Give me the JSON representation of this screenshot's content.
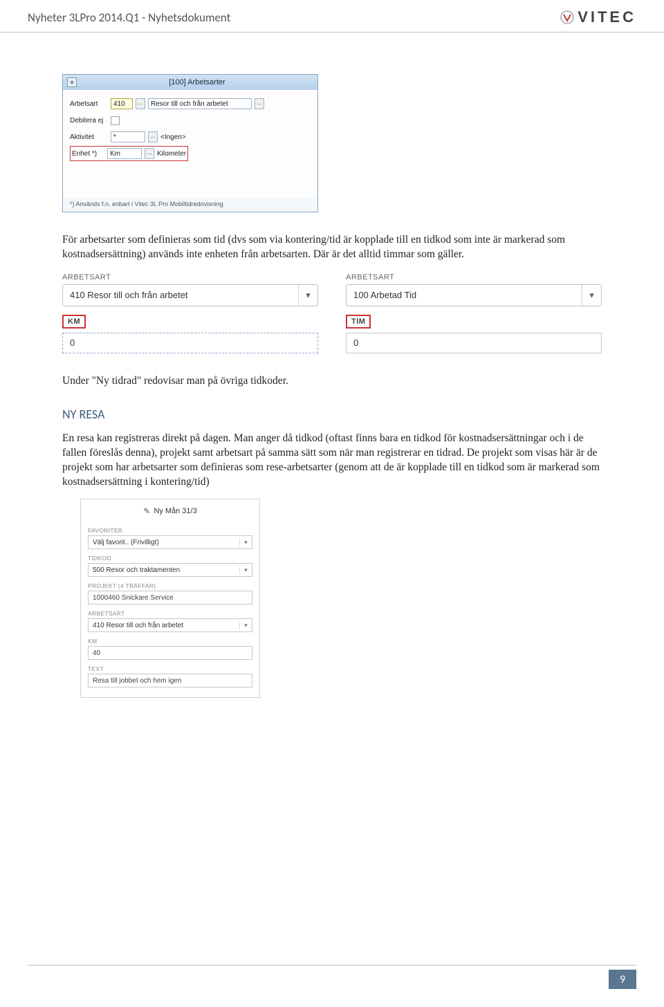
{
  "header": {
    "title": "Nyheter 3LPro 2014.Q1 - Nyhetsdokument",
    "brand": "VITEC"
  },
  "page_number": "9",
  "scr1": {
    "window_title": "[100]  Arbetsarter",
    "rows": {
      "arbetsart": {
        "label": "Arbetsart",
        "code": "410",
        "desc": "Resor till och från arbetet"
      },
      "debitera": {
        "label": "Debitera ej"
      },
      "aktivitet": {
        "label": "Aktivitet",
        "code": "*",
        "desc": "<Ingen>"
      },
      "enhet": {
        "label": "Enhet *)",
        "code": "Km",
        "desc": "Kilometer"
      }
    },
    "footnote": "*) Används f.n. enbart i Vitec 3L Pro Mobiltidredovisning."
  },
  "para1": "För arbetsarter som definieras som tid (dvs som via kontering/tid är kopplade till en tidkod som inte är markerad som kostnadsersättning) används inte enheten från arbetsarten. Där är det alltid timmar som gäller.",
  "scr2": {
    "left": {
      "caption": "ARBETSART",
      "value": "410 Resor till och från arbetet",
      "unit": "KM",
      "num": "0"
    },
    "right": {
      "caption": "ARBETSART",
      "value": "100 Arbetad Tid",
      "unit": "TIM",
      "num": "0"
    }
  },
  "para2": "Under \"Ny tidrad\" redovisar man på övriga tidkoder.",
  "h2": "NY RESA",
  "para3": "En resa kan registreras direkt på dagen. Man anger då tidkod (oftast finns bara en tidkod för kostnadsersättningar och i de fallen föreslås denna), projekt samt arbetsart på samma sätt som när man registrerar en tidrad. De projekt som visas här är de projekt som har arbetsarter som definieras som rese-arbetsarter (genom att de är kopplade till en tidkod som är markerad som kostnadsersättning i kontering/tid)",
  "scr3": {
    "header": "Ny Mån 31/3",
    "favoriter": {
      "label": "FAVORITER",
      "value": "Välj favorit.. (Frivilligt)"
    },
    "tidkod": {
      "label": "TIDKOD",
      "value": "500 Resor och traktamenten"
    },
    "projekt": {
      "label": "PROJEKT  (4 träffar)",
      "value": "1000460 Snickare Service"
    },
    "arbetsart": {
      "label": "ARBETSART",
      "value": "410 Resor till och från arbetet"
    },
    "km": {
      "label": "KM",
      "value": "40"
    },
    "text": {
      "label": "TEXT",
      "value": "Resa till jobbet och hem igen"
    }
  }
}
